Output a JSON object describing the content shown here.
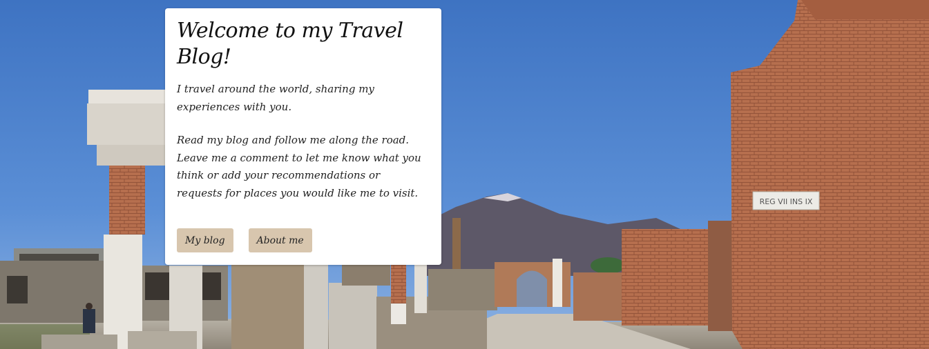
{
  "hero": {
    "title": "Welcome to my Travel Blog!",
    "intro": "I travel around the world, sharing my experiences with you.",
    "body": "Read my blog and follow me along the road. Leave me a comment to let me know what you think or add your recommendations or requests for places you would like me to visit."
  },
  "buttons": {
    "blog_label": "My blog",
    "about_label": "About me"
  },
  "photo": {
    "sign_text": "REG VII INS IX"
  },
  "colors": {
    "sky": "#4a7fc8",
    "button_bg": "#d8c6ae",
    "card_bg": "#ffffff"
  }
}
